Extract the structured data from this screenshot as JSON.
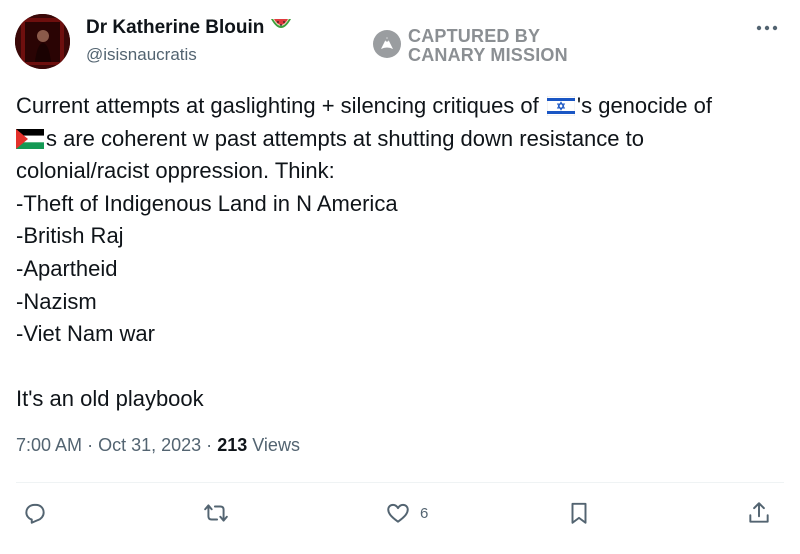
{
  "user": {
    "display_name": "Dr Katherine Blouin",
    "name_emoji_icon": "watermelon-icon",
    "handle": "@isisnaucratis"
  },
  "watermark": {
    "line1": "CAPTURED BY",
    "line2": "CANARY MISSION",
    "icon": "canary-bird-icon"
  },
  "more_icon": "more-horizontal-icon",
  "tweet": {
    "line1_before_flag": "Current attempts at gaslighting + silencing critiques of ",
    "line1_flag": "israel-flag-icon",
    "line1_after_flag": "'s genocide of",
    "line2_flag": "palestine-flag-icon",
    "line2_text": "s are coherent w past attempts at shutting down resistance to",
    "line3": "colonial/racist oppression. Think:",
    "list": [
      "-Theft of Indigenous Land in N America",
      "-British Raj",
      "-Apartheid",
      "-Nazism",
      "-Viet Nam war"
    ],
    "closing": "It's an old playbook"
  },
  "meta": {
    "time": "7:00 AM",
    "separator": "·",
    "date": "Oct 31, 2023",
    "views_count": "213",
    "views_label": "Views"
  },
  "actions": {
    "reply_icon": "reply-icon",
    "retweet_icon": "retweet-icon",
    "like_icon": "heart-icon",
    "like_count": "6",
    "bookmark_icon": "bookmark-icon",
    "share_icon": "share-icon"
  }
}
